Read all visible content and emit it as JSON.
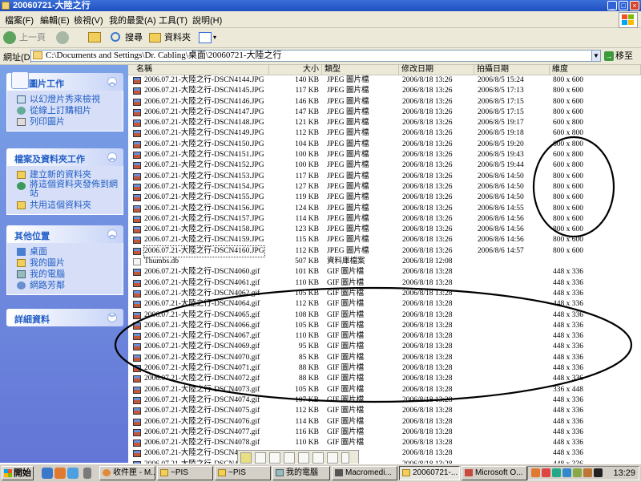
{
  "window": {
    "title": "20060721-大陸之行",
    "controls": {
      "minimize": "_",
      "maximize": "□",
      "close": "×"
    }
  },
  "menu": [
    "檔案(F)",
    "編輯(E)",
    "檢視(V)",
    "我的最愛(A)",
    "工具(T)",
    "說明(H)"
  ],
  "toolbar": {
    "back_label": "上一頁",
    "search_label": "搜尋",
    "folders_label": "資料夾"
  },
  "address": {
    "label": "網址(D)",
    "value": "C:\\Documents and Settings\\Dr. Cabling\\桌面\\20060721-大陸之行",
    "go_label": "移至"
  },
  "tasks": {
    "picture": {
      "title": "圖片工作",
      "items": [
        "以幻燈片秀來檢視",
        "從線上訂購相片",
        "列印圖片"
      ]
    },
    "file": {
      "title": "檔案及資料夾工作",
      "items": [
        "建立新的資料夾",
        "將這個資料夾發佈到網站",
        "共用這個資料夾"
      ]
    },
    "other": {
      "title": "其他位置",
      "items": [
        "桌面",
        "我的圖片",
        "我的電腦",
        "網路芳鄰"
      ]
    },
    "details": {
      "title": "詳細資料"
    }
  },
  "columns": [
    "名稱",
    "大小",
    "類型",
    "修改日期",
    "拍攝日期",
    "維度"
  ],
  "files": [
    {
      "name": "2006.07.21-大陸之行-DSCN4144.JPG",
      "size": "140 KB",
      "type": "JPEG 圖片檔",
      "modified": "2006/8/18 13:26",
      "taken": "2006/8/5 15:24",
      "dim": "800 x 600",
      "kind": "jpg"
    },
    {
      "name": "2006.07.21-大陸之行-DSCN4145.JPG",
      "size": "117 KB",
      "type": "JPEG 圖片檔",
      "modified": "2006/8/18 13:26",
      "taken": "2006/8/5 17:13",
      "dim": "800 x 600",
      "kind": "jpg"
    },
    {
      "name": "2006.07.21-大陸之行-DSCN4146.JPG",
      "size": "146 KB",
      "type": "JPEG 圖片檔",
      "modified": "2006/8/18 13:26",
      "taken": "2006/8/5 17:15",
      "dim": "800 x 600",
      "kind": "jpg"
    },
    {
      "name": "2006.07.21-大陸之行-DSCN4147.JPG",
      "size": "147 KB",
      "type": "JPEG 圖片檔",
      "modified": "2006/8/18 13:26",
      "taken": "2006/8/5 17:15",
      "dim": "800 x 600",
      "kind": "jpg"
    },
    {
      "name": "2006.07.21-大陸之行-DSCN4148.JPG",
      "size": "121 KB",
      "type": "JPEG 圖片檔",
      "modified": "2006/8/18 13:26",
      "taken": "2006/8/5 19:17",
      "dim": "600 x 800",
      "kind": "jpg"
    },
    {
      "name": "2006.07.21-大陸之行-DSCN4149.JPG",
      "size": "112 KB",
      "type": "JPEG 圖片檔",
      "modified": "2006/8/18 13:26",
      "taken": "2006/8/5 19:18",
      "dim": "600 x 800",
      "kind": "jpg"
    },
    {
      "name": "2006.07.21-大陸之行-DSCN4150.JPG",
      "size": "104 KB",
      "type": "JPEG 圖片檔",
      "modified": "2006/8/18 13:26",
      "taken": "2006/8/5 19:20",
      "dim": "600 x 800",
      "kind": "jpg"
    },
    {
      "name": "2006.07.21-大陸之行-DSCN4151.JPG",
      "size": "100 KB",
      "type": "JPEG 圖片檔",
      "modified": "2006/8/18 13:26",
      "taken": "2006/8/5 19:43",
      "dim": "600 x 800",
      "kind": "jpg"
    },
    {
      "name": "2006.07.21-大陸之行-DSCN4152.JPG",
      "size": "100 KB",
      "type": "JPEG 圖片檔",
      "modified": "2006/8/18 13:26",
      "taken": "2006/8/5 19:44",
      "dim": "600 x 800",
      "kind": "jpg"
    },
    {
      "name": "2006.07.21-大陸之行-DSCN4153.JPG",
      "size": "117 KB",
      "type": "JPEG 圖片檔",
      "modified": "2006/8/18 13:26",
      "taken": "2006/8/6 14:50",
      "dim": "800 x 600",
      "kind": "jpg"
    },
    {
      "name": "2006.07.21-大陸之行-DSCN4154.JPG",
      "size": "127 KB",
      "type": "JPEG 圖片檔",
      "modified": "2006/8/18 13:26",
      "taken": "2006/8/6 14:50",
      "dim": "800 x 600",
      "kind": "jpg"
    },
    {
      "name": "2006.07.21-大陸之行-DSCN4155.JPG",
      "size": "119 KB",
      "type": "JPEG 圖片檔",
      "modified": "2006/8/18 13:26",
      "taken": "2006/8/6 14:50",
      "dim": "800 x 600",
      "kind": "jpg"
    },
    {
      "name": "2006.07.21-大陸之行-DSCN4156.JPG",
      "size": "124 KB",
      "type": "JPEG 圖片檔",
      "modified": "2006/8/18 13:26",
      "taken": "2006/8/6 14:55",
      "dim": "800 x 600",
      "kind": "jpg"
    },
    {
      "name": "2006.07.21-大陸之行-DSCN4157.JPG",
      "size": "114 KB",
      "type": "JPEG 圖片檔",
      "modified": "2006/8/18 13:26",
      "taken": "2006/8/6 14:56",
      "dim": "800 x 600",
      "kind": "jpg"
    },
    {
      "name": "2006.07.21-大陸之行-DSCN4158.JPG",
      "size": "123 KB",
      "type": "JPEG 圖片檔",
      "modified": "2006/8/18 13:26",
      "taken": "2006/8/6 14:56",
      "dim": "800 x 600",
      "kind": "jpg"
    },
    {
      "name": "2006.07.21-大陸之行-DSCN4159.JPG",
      "size": "115 KB",
      "type": "JPEG 圖片檔",
      "modified": "2006/8/18 13:26",
      "taken": "2006/8/6 14:56",
      "dim": "800 x 600",
      "kind": "jpg"
    },
    {
      "name": "2006.07.21-大陸之行-DSCN4160.JPG",
      "size": "112 KB",
      "type": "JPEG 圖片檔",
      "modified": "2006/8/18 13:26",
      "taken": "2006/8/6 14:57",
      "dim": "800 x 600",
      "kind": "jpg",
      "selected": true
    },
    {
      "name": "Thumbs.db",
      "size": "507 KB",
      "type": "資料庫檔案",
      "modified": "2006/8/18 12:08",
      "taken": "",
      "dim": "",
      "kind": "db"
    },
    {
      "name": "2006.07.21-大陸之行-DSCN4060.gif",
      "size": "101 KB",
      "type": "GIF 圖片檔",
      "modified": "2006/8/18 13:28",
      "taken": "",
      "dim": "448 x 336",
      "kind": "gif"
    },
    {
      "name": "2006.07.21-大陸之行-DSCN4061.gif",
      "size": "110 KB",
      "type": "GIF 圖片檔",
      "modified": "2006/8/18 13:28",
      "taken": "",
      "dim": "448 x 336",
      "kind": "gif"
    },
    {
      "name": "2006.07.21-大陸之行-DSCN4062.gif",
      "size": "105 KB",
      "type": "GIF 圖片檔",
      "modified": "2006/8/18 13:28",
      "taken": "",
      "dim": "448 x 336",
      "kind": "gif"
    },
    {
      "name": "2006.07.21-大陸之行-DSCN4064.gif",
      "size": "112 KB",
      "type": "GIF 圖片檔",
      "modified": "2006/8/18 13:28",
      "taken": "",
      "dim": "448 x 336",
      "kind": "gif"
    },
    {
      "name": "2006.07.21-大陸之行-DSCN4065.gif",
      "size": "108 KB",
      "type": "GIF 圖片檔",
      "modified": "2006/8/18 13:28",
      "taken": "",
      "dim": "448 x 336",
      "kind": "gif"
    },
    {
      "name": "2006.07.21-大陸之行-DSCN4066.gif",
      "size": "105 KB",
      "type": "GIF 圖片檔",
      "modified": "2006/8/18 13:28",
      "taken": "",
      "dim": "448 x 336",
      "kind": "gif"
    },
    {
      "name": "2006.07.21-大陸之行-DSCN4067.gif",
      "size": "110 KB",
      "type": "GIF 圖片檔",
      "modified": "2006/8/18 13:28",
      "taken": "",
      "dim": "448 x 336",
      "kind": "gif"
    },
    {
      "name": "2006.07.21-大陸之行-DSCN4069.gif",
      "size": "95 KB",
      "type": "GIF 圖片檔",
      "modified": "2006/8/18 13:28",
      "taken": "",
      "dim": "448 x 336",
      "kind": "gif"
    },
    {
      "name": "2006.07.21-大陸之行-DSCN4070.gif",
      "size": "85 KB",
      "type": "GIF 圖片檔",
      "modified": "2006/8/18 13:28",
      "taken": "",
      "dim": "448 x 336",
      "kind": "gif"
    },
    {
      "name": "2006.07.21-大陸之行-DSCN4071.gif",
      "size": "88 KB",
      "type": "GIF 圖片檔",
      "modified": "2006/8/18 13:28",
      "taken": "",
      "dim": "448 x 336",
      "kind": "gif"
    },
    {
      "name": "2006.07.21-大陸之行-DSCN4072.gif",
      "size": "88 KB",
      "type": "GIF 圖片檔",
      "modified": "2006/8/18 13:28",
      "taken": "",
      "dim": "448 x 336",
      "kind": "gif"
    },
    {
      "name": "2006.07.21-大陸之行-DSCN4073.gif",
      "size": "105 KB",
      "type": "GIF 圖片檔",
      "modified": "2006/8/18 13:28",
      "taken": "",
      "dim": "336 x 448",
      "kind": "gif"
    },
    {
      "name": "2006.07.21-大陸之行-DSCN4074.gif",
      "size": "107 KB",
      "type": "GIF 圖片檔",
      "modified": "2006/8/18 13:28",
      "taken": "",
      "dim": "448 x 336",
      "kind": "gif"
    },
    {
      "name": "2006.07.21-大陸之行-DSCN4075.gif",
      "size": "112 KB",
      "type": "GIF 圖片檔",
      "modified": "2006/8/18 13:28",
      "taken": "",
      "dim": "448 x 336",
      "kind": "gif"
    },
    {
      "name": "2006.07.21-大陸之行-DSCN4076.gif",
      "size": "114 KB",
      "type": "GIF 圖片檔",
      "modified": "2006/8/18 13:28",
      "taken": "",
      "dim": "448 x 336",
      "kind": "gif"
    },
    {
      "name": "2006.07.21-大陸之行-DSCN4077.gif",
      "size": "116 KB",
      "type": "GIF 圖片檔",
      "modified": "2006/8/18 13:28",
      "taken": "",
      "dim": "448 x 336",
      "kind": "gif"
    },
    {
      "name": "2006.07.21-大陸之行-DSCN4078.gif",
      "size": "110 KB",
      "type": "GIF 圖片檔",
      "modified": "2006/8/18 13:28",
      "taken": "",
      "dim": "448 x 336",
      "kind": "gif"
    },
    {
      "name": "2006.07.21-大陸之行-DSCN4",
      "size": "",
      "type": "",
      "modified": "2006/8/18 13:28",
      "taken": "",
      "dim": "448 x 336",
      "kind": "gif"
    },
    {
      "name": "2006.07.21-大陸之行-DSCN4",
      "size": "",
      "type": "",
      "modified": "2006/8/18 13:28",
      "taken": "",
      "dim": "448 x 336",
      "kind": "gif"
    }
  ],
  "taskbar": {
    "start_label": "開始",
    "tasks": [
      "收件匣 - M...",
      "~PIS",
      "~PIS",
      "我的電腦",
      "Macromedi...",
      "20060721-...",
      "Microsoft O..."
    ],
    "clock": "13:29"
  },
  "colors": {
    "titlebar": "#1f4fc2",
    "task_pane": "#6f8ee0",
    "annotation": "#000000"
  }
}
